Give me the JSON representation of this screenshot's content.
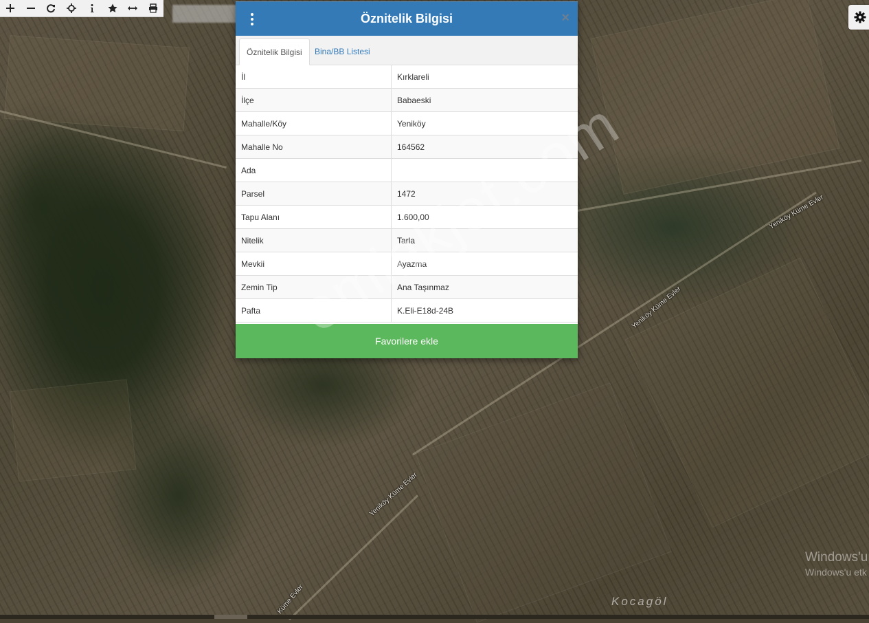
{
  "toolbar": {
    "tools": [
      {
        "icon": "plus-icon",
        "name": "zoom-in-button"
      },
      {
        "icon": "minus-icon",
        "name": "zoom-out-button"
      },
      {
        "icon": "refresh-icon",
        "name": "refresh-button"
      },
      {
        "icon": "crosshair-icon",
        "name": "locate-button"
      },
      {
        "icon": "info-icon",
        "name": "info-button"
      },
      {
        "icon": "star-icon",
        "name": "favorites-button"
      },
      {
        "icon": "measure-icon",
        "name": "measure-button"
      },
      {
        "icon": "print-icon",
        "name": "print-button"
      }
    ]
  },
  "settings": {
    "icon": "gear-icon"
  },
  "map": {
    "place_label": "Kocagöl",
    "road_labels": [
      "Yeniköy Küme Evler",
      "Yeniköy Küme Evler",
      "Yeniköy Küme Evler",
      "Küme Evler"
    ],
    "watermark": "emlakjet.com"
  },
  "modal": {
    "title": "Öznitelik Bilgisi",
    "close_icon": "close-icon",
    "menu_icon": "kebab-menu-icon",
    "tabs": [
      {
        "label": "Öznitelik Bilgisi",
        "active": true
      },
      {
        "label": "Bina/BB Listesi",
        "active": false
      }
    ],
    "rows": [
      {
        "key": "İl",
        "value": "Kırklareli"
      },
      {
        "key": "İlçe",
        "value": "Babaeski"
      },
      {
        "key": "Mahalle/Köy",
        "value": "Yeniköy"
      },
      {
        "key": "Mahalle No",
        "value": "164562"
      },
      {
        "key": "Ada",
        "value": ""
      },
      {
        "key": "Parsel",
        "value": "1472"
      },
      {
        "key": "Tapu Alanı",
        "value": "1.600,00"
      },
      {
        "key": "Nitelik",
        "value": "Tarla"
      },
      {
        "key": "Mevkii",
        "value": "Ayazma"
      },
      {
        "key": "Zemin Tip",
        "value": "Ana Taşınmaz"
      },
      {
        "key": "Pafta",
        "value": "K.Eli-E18d-24B"
      }
    ],
    "favorite_button": "Favorilere ekle"
  },
  "windows_notice": {
    "line1": "Windows'u",
    "line2": "Windows'u etk"
  },
  "colors": {
    "header": "#337ab7",
    "favorite": "#5cb85c",
    "link": "#337ab7"
  }
}
